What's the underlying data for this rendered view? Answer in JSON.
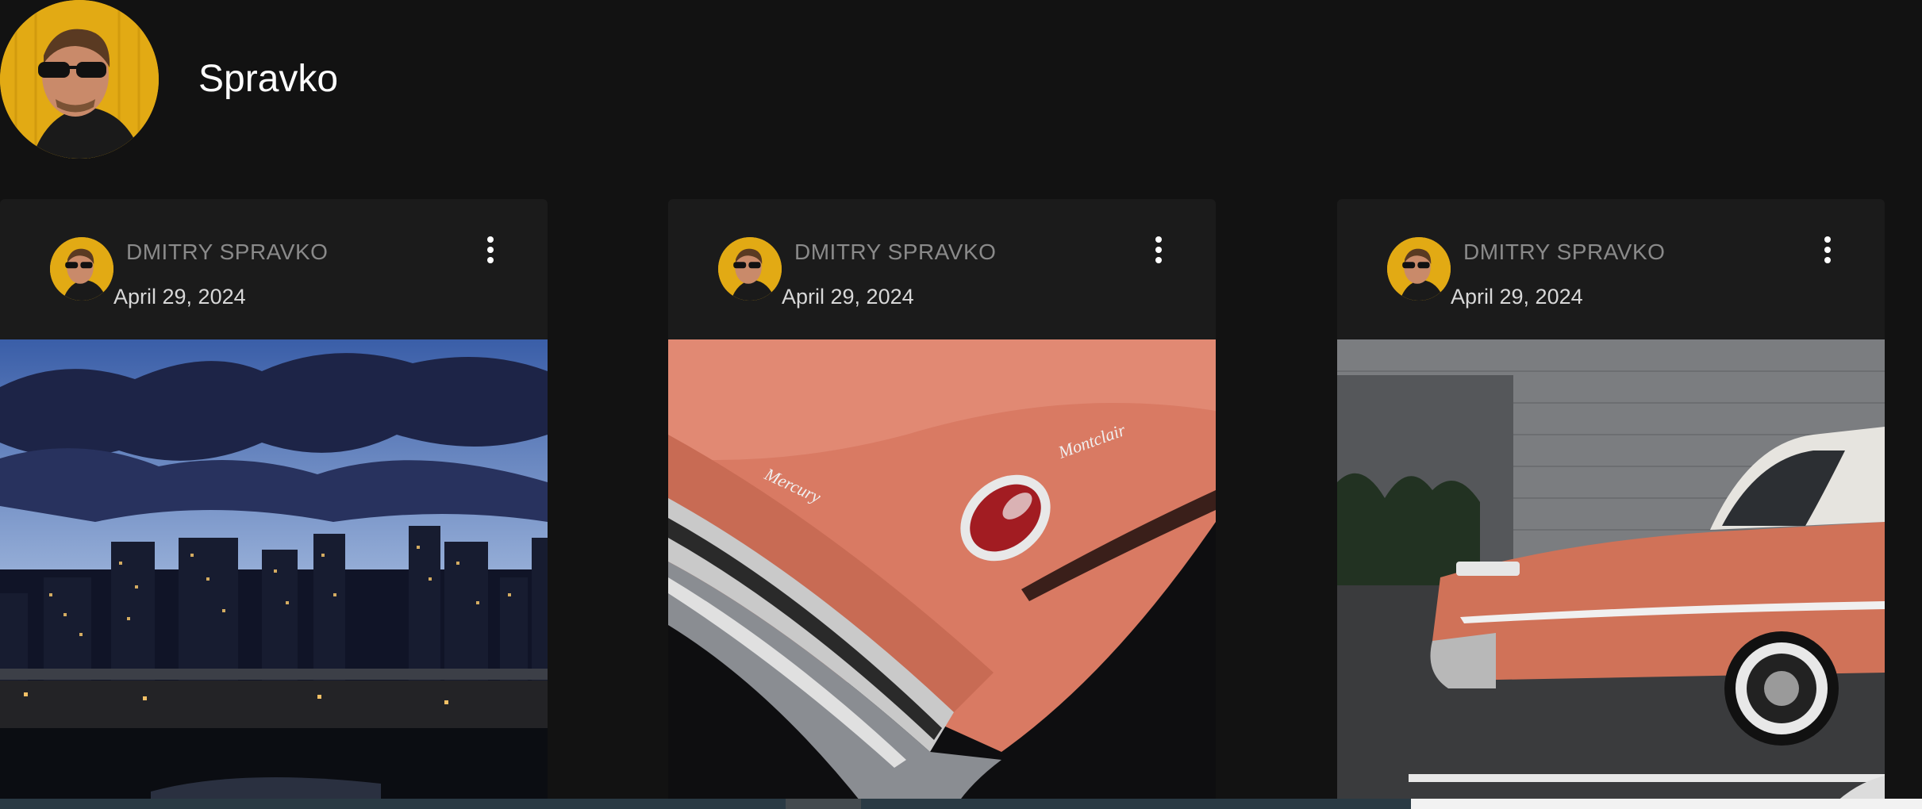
{
  "profile": {
    "name": "Spravko"
  },
  "posts": [
    {
      "author": "DMITRY SPRAVKO",
      "date": "April 29, 2024",
      "image": "city-skyline-at-dusk"
    },
    {
      "author": "DMITRY SPRAVKO",
      "date": "April 29, 2024",
      "image": "mercury-car-tail-fin"
    },
    {
      "author": "DMITRY SPRAVKO",
      "date": "April 29, 2024",
      "image": "vintage-coral-car-parked"
    }
  ],
  "icons": {
    "more": "more-vertical-icon"
  },
  "colors": {
    "background": "#121212",
    "card": "#1b1b1b",
    "avatar_bg": "#e0a812",
    "author_text": "#8a8a8a",
    "date_text": "#d8d8d8"
  }
}
